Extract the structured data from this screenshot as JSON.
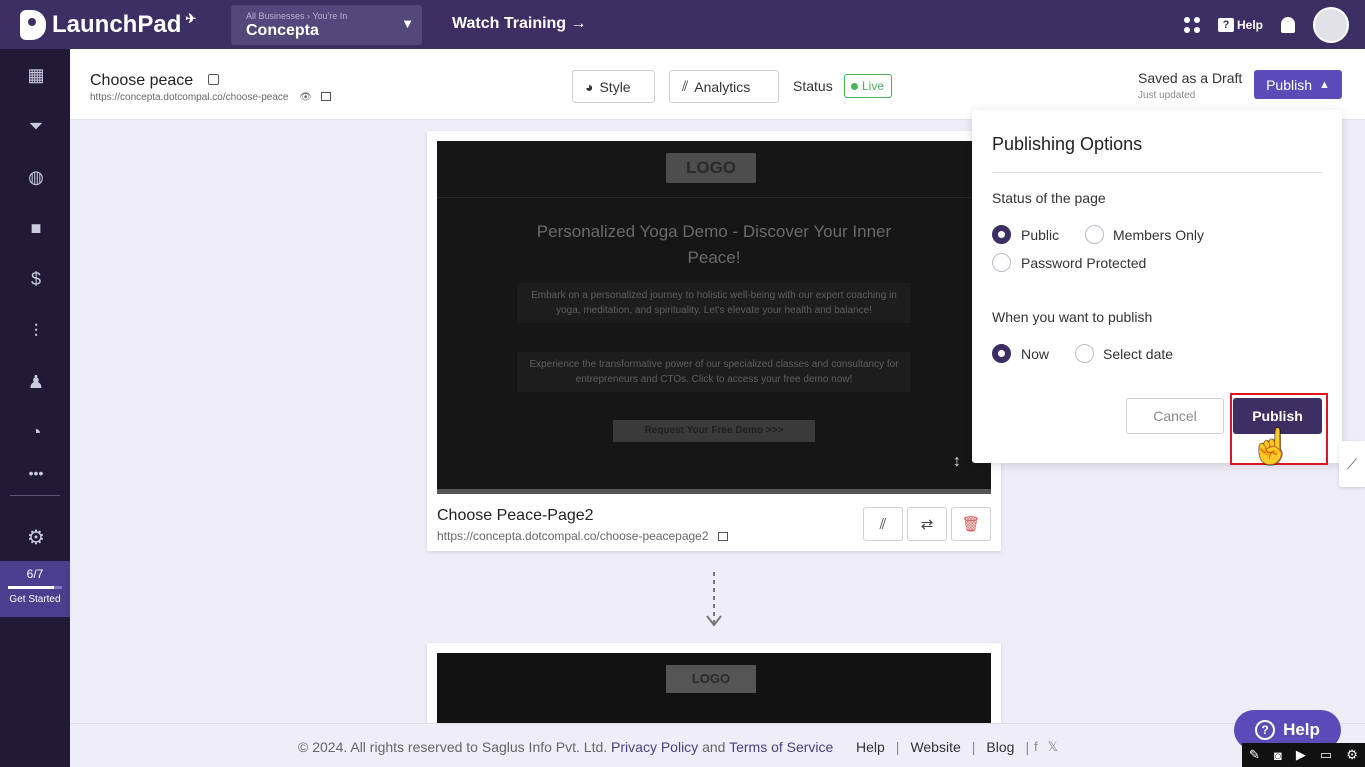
{
  "topbar": {
    "app_name": "LaunchPad",
    "business_crumb": "All Businesses › You're In",
    "business_name": "Concepta",
    "watch_training": "Watch Training →",
    "help_label": "Help"
  },
  "sidebar": {
    "items": [
      {
        "name": "dashboard-icon",
        "glyph": "▦"
      },
      {
        "name": "funnel-icon",
        "glyph": "⏷"
      },
      {
        "name": "globe-icon",
        "glyph": "◍"
      },
      {
        "name": "video-icon",
        "glyph": "■"
      },
      {
        "name": "dollar-icon",
        "glyph": "$"
      },
      {
        "name": "analytics-icon",
        "glyph": "⫶"
      },
      {
        "name": "people-icon",
        "glyph": "♟"
      },
      {
        "name": "gauge-icon",
        "glyph": "◔"
      },
      {
        "name": "more-icon",
        "glyph": "•••"
      }
    ],
    "settings_glyph": "⚙",
    "get_started": {
      "count": "6/7",
      "label": "Get Started",
      "progress": 0.86
    }
  },
  "header": {
    "page_title": "Choose peace",
    "page_url": "https://concepta.dotcompal.co/choose-peace",
    "style_label": "Style",
    "analytics_label": "Analytics",
    "status_label": "Status",
    "live_label": "Live",
    "saved_label": "Saved as a Draft",
    "saved_sub": "Just updated",
    "publish_label": "Publish"
  },
  "card1": {
    "preview": {
      "logo": "LOGO",
      "headline": "Personalized Yoga Demo - Discover Your Inner Peace!",
      "para1": "Embark on a personalized journey to holistic well-being with our expert coaching in yoga, meditation, and spirituality. Let's elevate your health and balance!",
      "para2": "Experience the transformative power of our specialized classes and consultancy for entrepreneurs and CTOs. Click to access your free demo now!",
      "cta": "Request Your Free Demo >>>"
    },
    "title": "Choose Peace-Page2",
    "url": "https://concepta.dotcompal.co/choose-peacepage2"
  },
  "card2": {
    "logo": "LOGO"
  },
  "popover": {
    "title": "Publishing Options",
    "status_heading": "Status of the page",
    "status_options": [
      {
        "label": "Public",
        "selected": true
      },
      {
        "label": "Members Only",
        "selected": false
      },
      {
        "label": "Password Protected",
        "selected": false
      }
    ],
    "when_heading": "When you want to publish",
    "when_options": [
      {
        "label": "Now",
        "selected": true
      },
      {
        "label": "Select date",
        "selected": false
      }
    ],
    "cancel_label": "Cancel",
    "publish_label": "Publish"
  },
  "footer": {
    "copyright": "©  2024. All rights reserved to Saglus Info Pvt. Ltd.",
    "privacy": "Privacy Policy",
    "and": "and",
    "terms": "Terms of Service",
    "links": [
      "Help",
      "Website",
      "Blog"
    ]
  },
  "help_float": "Help",
  "colors": {
    "brand": "#3d2f63",
    "accent": "#5a4bb8",
    "live": "#46b35a",
    "highlight": "#e0151b"
  }
}
